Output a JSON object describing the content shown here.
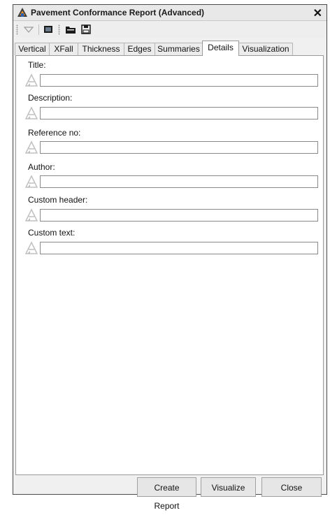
{
  "window": {
    "title": "Pavement Conformance Report (Advanced)",
    "close_glyph": "✕"
  },
  "toolbar": {
    "icons": [
      "dropdown-arrow-icon",
      "screen-icon",
      "folder-open-icon",
      "save-icon"
    ]
  },
  "tabs": [
    {
      "label": "Vertical"
    },
    {
      "label": "XFall"
    },
    {
      "label": "Thickness"
    },
    {
      "label": "Edges"
    },
    {
      "label": "Summaries"
    },
    {
      "label": "Details",
      "active": true
    },
    {
      "label": "Visualization"
    }
  ],
  "fields": [
    {
      "label": "Title:",
      "value": ""
    },
    {
      "label": "Description:",
      "value": ""
    },
    {
      "label": "Reference no:",
      "value": ""
    },
    {
      "label": "Author:",
      "value": ""
    },
    {
      "label": "Custom header:",
      "value": ""
    },
    {
      "label": "Custom text:",
      "value": ""
    }
  ],
  "buttons": {
    "create_report": "Create Report",
    "visualize": "Visualize",
    "close": "Close"
  }
}
